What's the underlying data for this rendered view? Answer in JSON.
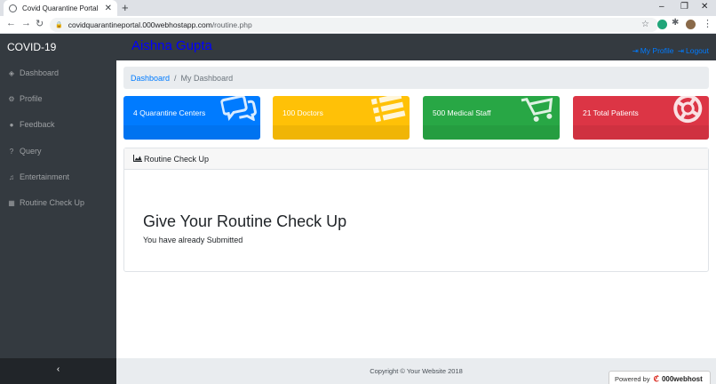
{
  "browser": {
    "tab_title": "Covid Quarantine Portal",
    "url_host": "covidquarantineportal.000webhostapp.com",
    "url_path": "/routine.php"
  },
  "app": {
    "brand": "COVID-19",
    "username": "Aishna Gupta",
    "my_profile": "My Profile",
    "logout": "Logout"
  },
  "sidebar": {
    "items": [
      {
        "label": "Dashboard",
        "icon": "dashboard-icon",
        "glyph": "◈"
      },
      {
        "label": "Profile",
        "icon": "profile-icon",
        "glyph": "⚙"
      },
      {
        "label": "Feedback",
        "icon": "comment-icon",
        "glyph": "●"
      },
      {
        "label": "Query",
        "icon": "question-icon",
        "glyph": "?"
      },
      {
        "label": "Entertainment",
        "icon": "music-icon",
        "glyph": "♫"
      },
      {
        "label": "Routine Check Up",
        "icon": "calendar-icon",
        "glyph": "▦"
      }
    ],
    "collapse": "‹"
  },
  "breadcrumb": {
    "link": "Dashboard",
    "separator": "/",
    "active": "My Dashboard"
  },
  "cards": [
    {
      "label": "4 Quarantine Centers",
      "icon": "comments-icon",
      "color": "#007bff"
    },
    {
      "label": "100 Doctors",
      "icon": "list-icon",
      "color": "#ffc107"
    },
    {
      "label": "500 Medical Staff",
      "icon": "cart-icon",
      "color": "#28a745"
    },
    {
      "label": "21 Total Patients",
      "icon": "life-ring-icon",
      "color": "#dc3545"
    }
  ],
  "panel": {
    "header": "Routine Check Up",
    "title": "Give Your Routine Check Up",
    "message": "You have already Submitted"
  },
  "footer": {
    "copyright": "Copyright © Your Website 2018",
    "powered_by": "Powered by",
    "powered_brand": "000webhost"
  }
}
